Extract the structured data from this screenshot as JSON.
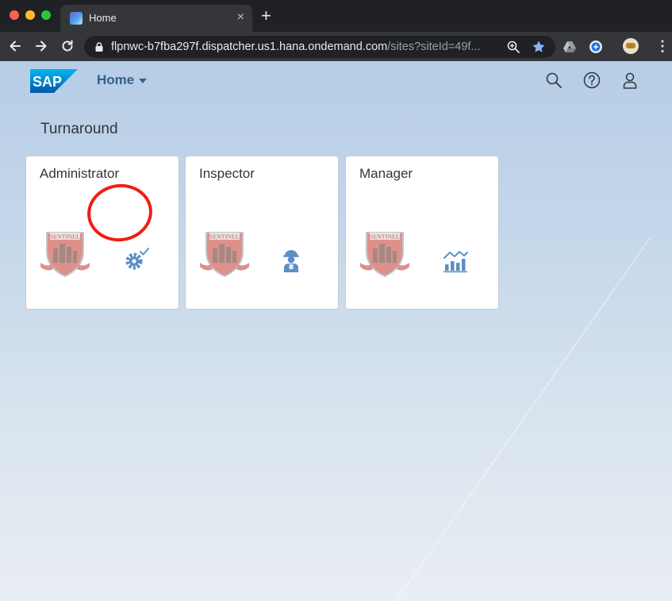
{
  "browser": {
    "tab_title": "Home",
    "tab_close": "×",
    "new_tab": "+",
    "url_host": "flpnwc-b7fba297f.dispatcher.us1.hana.ondemand.com",
    "url_path": "/sites?siteId=49f..."
  },
  "shell": {
    "title": "Home"
  },
  "group": {
    "title": "Turnaround"
  },
  "tiles": [
    {
      "title": "Administrator",
      "icon": "gear-check-icon",
      "logo_text": "SENTINEL"
    },
    {
      "title": "Inspector",
      "icon": "worker-icon",
      "logo_text": "SENTINEL"
    },
    {
      "title": "Manager",
      "icon": "chart-icon",
      "logo_text": "SENTINEL"
    }
  ],
  "colors": {
    "sap_blue": "#0a6ed1",
    "shell_text": "#346187",
    "tile_icon": "#5b8fc6",
    "annotation_red": "#f21d14"
  }
}
